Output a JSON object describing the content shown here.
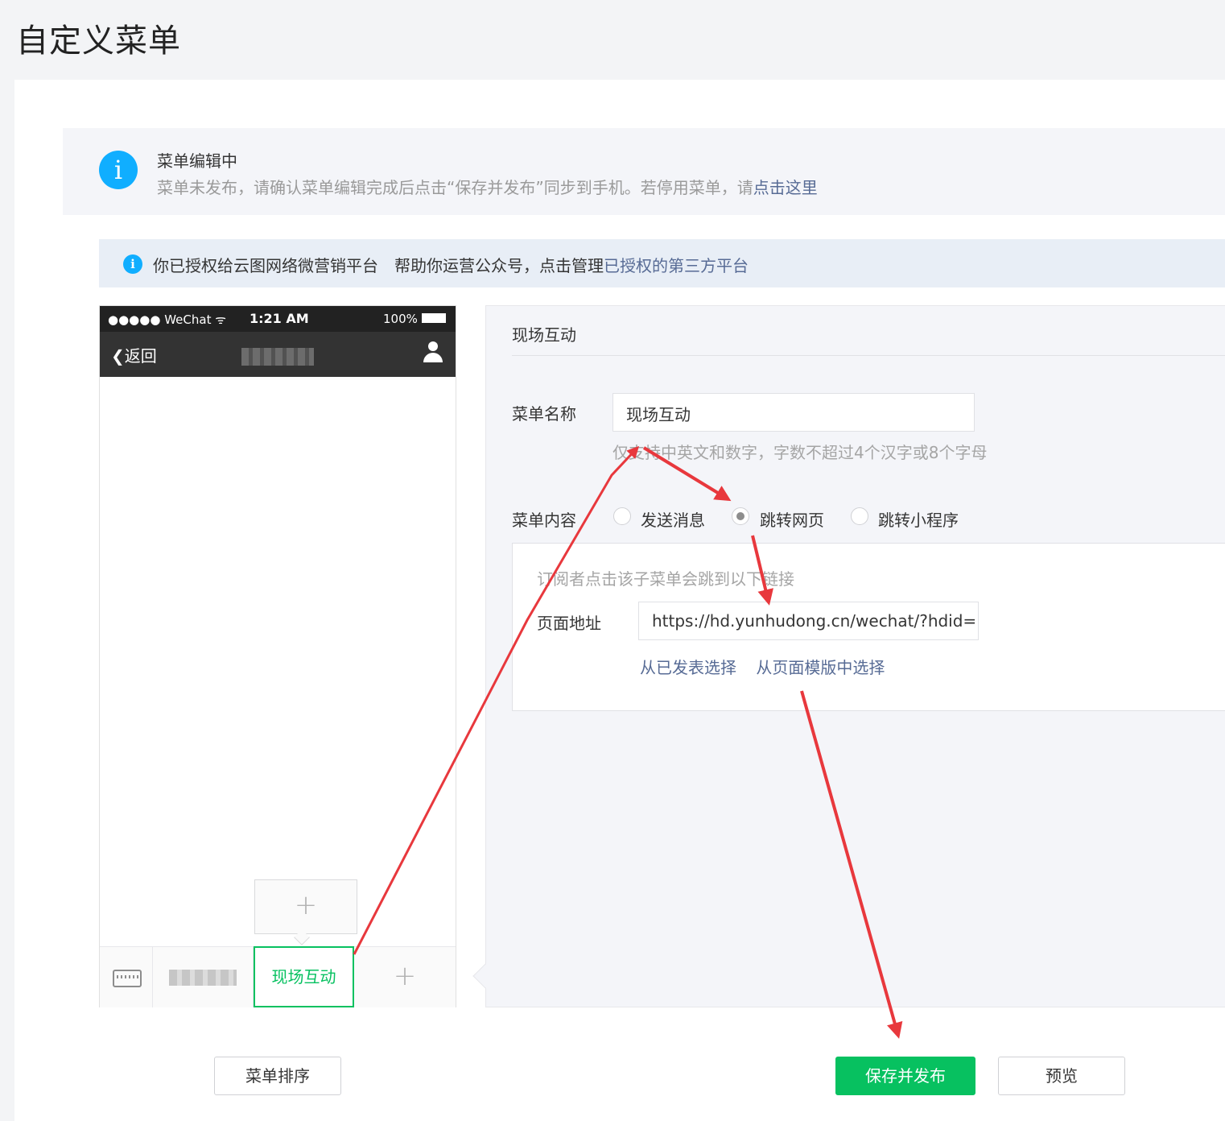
{
  "page": {
    "title": "自定义菜单"
  },
  "notice": {
    "icon": "i",
    "title": "菜单编辑中",
    "desc_prefix": "菜单未发布，请确认菜单编辑完成后点击“保存并发布”同步到手机。若停用菜单，请",
    "desc_link": "点击这里"
  },
  "auth": {
    "icon": "i",
    "text": "你已授权给云图网络微营销平台　帮助你运营公众号，点击管理",
    "link": "已授权的第三方平台"
  },
  "phone": {
    "carrier": "●●●●● WeChat ᯤ",
    "time": "1:21 AM",
    "battery": "100%",
    "back": "❮返回",
    "sub_add": "+",
    "menu_active": "现场互动",
    "menu_add": "+"
  },
  "panel": {
    "title": "现场互动",
    "name_label": "菜单名称",
    "name_value": "现场互动",
    "name_hint": "仅支持中英文和数字，字数不超过4个汉字或8个字母",
    "content_label": "菜单内容",
    "options": [
      {
        "label": "发送消息",
        "checked": false
      },
      {
        "label": "跳转网页",
        "checked": true
      },
      {
        "label": "跳转小程序",
        "checked": false
      }
    ],
    "content_hint": "订阅者点击该子菜单会跳到以下链接",
    "url_label": "页面地址",
    "url_value": "https://hd.yunhudong.cn/wechat/?hdid=E",
    "link_published": "从已发表选择",
    "link_template": "从页面模版中选择"
  },
  "buttons": {
    "sort": "菜单排序",
    "save": "保存并发布",
    "preview": "预览"
  },
  "colors": {
    "primary_green": "#07c160",
    "info_blue": "#10aeff",
    "link": "#576b95",
    "annotation_red": "#e8383d"
  }
}
